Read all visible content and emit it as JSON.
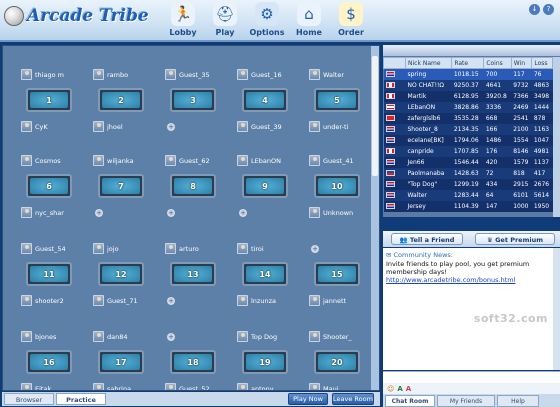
{
  "app": {
    "name": "Arcade Tribe",
    "nav": [
      {
        "label": "Lobby",
        "icon": "runner-icon",
        "glyph": "🏃"
      },
      {
        "label": "Play",
        "icon": "helmet-icon",
        "glyph": "⛑"
      },
      {
        "label": "Options",
        "icon": "gear-icon",
        "glyph": "⚙"
      },
      {
        "label": "Home",
        "icon": "house-icon",
        "glyph": "⌂"
      },
      {
        "label": "Order",
        "icon": "coins-icon",
        "glyph": "$"
      }
    ],
    "window_buttons": [
      "↓",
      "?"
    ]
  },
  "lobby": {
    "tables": [
      {
        "number": "1",
        "top": "thiago m",
        "bot": "CyK"
      },
      {
        "number": "2",
        "top": "rambo",
        "bot": "jhoel"
      },
      {
        "number": "3",
        "top": "Guest_35",
        "bot": ""
      },
      {
        "number": "4",
        "top": "Guest_16",
        "bot": "Guest_39"
      },
      {
        "number": "5",
        "top": "Walter",
        "bot": "under-ti"
      },
      {
        "number": "6",
        "top": "Cosmos",
        "bot": "nyc_shar"
      },
      {
        "number": "7",
        "top": "wiljanka",
        "bot": ""
      },
      {
        "number": "8",
        "top": "Guest_62",
        "bot": ""
      },
      {
        "number": "9",
        "top": "LEbanON",
        "bot": ""
      },
      {
        "number": "10",
        "top": "Guest_41",
        "bot": "Unknown"
      },
      {
        "number": "11",
        "top": "Guest_54",
        "bot": "shooter2"
      },
      {
        "number": "12",
        "top": "jojo",
        "bot": "Guest_71"
      },
      {
        "number": "13",
        "top": "arturo",
        "bot": ""
      },
      {
        "number": "14",
        "top": "tiroi",
        "bot": "lnzunza"
      },
      {
        "number": "15",
        "top": "",
        "bot": "jannett"
      },
      {
        "number": "16",
        "top": "bjones",
        "bot": "Eitak"
      },
      {
        "number": "17",
        "top": "dan84",
        "bot": "sabrina"
      },
      {
        "number": "18",
        "top": "",
        "bot": "Guest_52"
      },
      {
        "number": "19",
        "top": "Top Dog",
        "bot": "antony"
      },
      {
        "number": "20",
        "top": "Shooter_",
        "bot": "Maui"
      }
    ],
    "tabs": [
      "Browser",
      "Practice"
    ],
    "play_now": "Play Now",
    "leave_room": "Leave Room"
  },
  "players": {
    "columns": [
      "Nick Name",
      "Rate",
      "Coins",
      "Win",
      "Loss"
    ],
    "rows": [
      {
        "nick": "spring",
        "rate": "1018.15",
        "coins": "700",
        "win": "117",
        "loss": "76",
        "flag": "us",
        "selected": true
      },
      {
        "nick": "NO CHAT!!Ω",
        "rate": "9250.37",
        "coins": "4641",
        "win": "9732",
        "loss": "4863",
        "flag": "ca",
        "selected": false
      },
      {
        "nick": "Martik",
        "rate": "6128.95",
        "coins": "3920.8",
        "win": "7366",
        "loss": "3498",
        "flag": "ca",
        "selected": false
      },
      {
        "nick": "LEbanON",
        "rate": "3828.86",
        "coins": "3336",
        "win": "2469",
        "loss": "1444",
        "flag": "lb",
        "selected": false
      },
      {
        "nick": "zaferglslb6",
        "rate": "3535.28",
        "coins": "668",
        "win": "2541",
        "loss": "878",
        "flag": "tr",
        "selected": false
      },
      {
        "nick": "Shooter_8",
        "rate": "2134.35",
        "coins": "166",
        "win": "2100",
        "loss": "1163",
        "flag": "us",
        "selected": false
      },
      {
        "nick": "ecelane[BK]",
        "rate": "1794.06",
        "coins": "1486",
        "win": "1554",
        "loss": "1047",
        "flag": "us",
        "selected": false
      },
      {
        "nick": "canpride",
        "rate": "1707.85",
        "coins": "176",
        "win": "8146",
        "loss": "4981",
        "flag": "ca",
        "selected": false
      },
      {
        "nick": "Jen66",
        "rate": "1546.44",
        "coins": "420",
        "win": "1579",
        "loss": "1137",
        "flag": "us",
        "selected": false
      },
      {
        "nick": "Paolmanaba",
        "rate": "1428.63",
        "coins": "72",
        "win": "818",
        "loss": "417",
        "flag": "ph",
        "selected": false
      },
      {
        "nick": "\"Top Dog\"",
        "rate": "1299.19",
        "coins": "434",
        "win": "2915",
        "loss": "2676",
        "flag": "us",
        "selected": false
      },
      {
        "nick": "Walter",
        "rate": "1283.44",
        "coins": "64",
        "win": "6101",
        "loss": "5614",
        "flag": "us",
        "selected": false
      },
      {
        "nick": "Jersey",
        "rate": "1104.39",
        "coins": "147",
        "win": "1000",
        "loss": "1950",
        "flag": "us",
        "selected": false
      }
    ],
    "tell_friend": "Tell a Friend",
    "get_premium": "Get Premium"
  },
  "news": {
    "heading": "Community News:",
    "body": "Invite friends to play pool, you get premium membership days!",
    "link": "http://www.arcadetribe.com/bonus.html",
    "watermark": "soft32.com"
  },
  "right_tabs": [
    "Chat Room",
    "My Friends",
    "Help"
  ],
  "colors": {
    "header_blue": "#1e5fb4",
    "lobby_bg": "#5d80a8",
    "felt": "#2b7fa8",
    "selected_row": "#2a5bb8"
  }
}
